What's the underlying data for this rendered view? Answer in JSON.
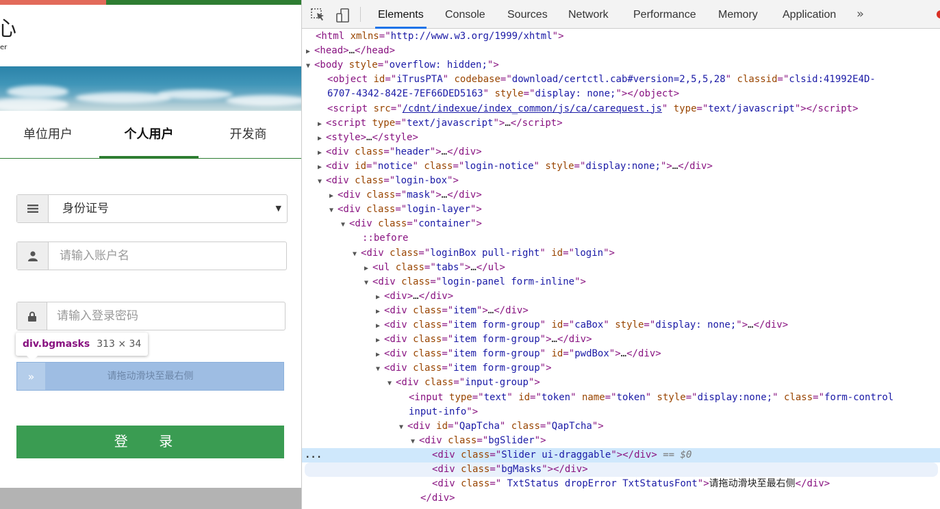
{
  "page": {
    "logo": {
      "glyph": "心",
      "text": "er"
    },
    "tabs": [
      {
        "label": "单位用户",
        "active": false
      },
      {
        "label": "个人用户",
        "active": true
      },
      {
        "label": "开发商",
        "active": false
      }
    ],
    "id_type": {
      "value": "身份证号",
      "icon": "list-icon"
    },
    "account": {
      "placeholder": "请输入账户名",
      "icon": "user-icon"
    },
    "password": {
      "placeholder": "请输入登录密码",
      "icon": "lock-icon"
    },
    "tooltip": {
      "tag": "div.bgmasks",
      "size": "313 × 34"
    },
    "slider": {
      "text": "请拖动滑块至最右侧",
      "handle": "»"
    },
    "login_label": "登 录"
  },
  "devtools": {
    "panels": [
      {
        "label": "Elements",
        "active": true
      },
      {
        "label": "Console"
      },
      {
        "label": "Sources"
      },
      {
        "label": "Network"
      },
      {
        "label": "Performance"
      },
      {
        "label": "Memory"
      },
      {
        "label": "Application"
      }
    ],
    "more": "»",
    "lines": [
      {
        "indent": 0,
        "tri": "",
        "html": "<span class=\"tg\">&lt;html</span> <span class=\"an\">xmlns</span><span class=\"tg\">=</span>\"<span class=\"av\">http://www.w3.org/1999/xhtml</span>\"<span class=\"tg\">&gt;</span>"
      },
      {
        "indent": 0,
        "tri": "▶",
        "html": "<span class=\"tg\">&lt;head&gt;</span><span class=\"tx\">…</span><span class=\"tg\">&lt;/head&gt;</span>"
      },
      {
        "indent": 0,
        "tri": "▼",
        "html": "<span class=\"tg\">&lt;body</span> <span class=\"an\">style</span><span class=\"tg\">=</span>\"<span class=\"av\">overflow: hidden;</span>\"<span class=\"tg\">&gt;</span>"
      },
      {
        "indent": 1,
        "tri": "",
        "html": "<span class=\"tg\">&lt;object</span> <span class=\"an\">id</span><span class=\"tg\">=</span>\"<span class=\"av\">iTrusPTA</span>\" <span class=\"an\">codebase</span><span class=\"tg\">=</span>\"<span class=\"av\">download/certctl.cab#version=2,5,5,28</span>\" <span class=\"an\">classid</span><span class=\"tg\">=</span>\"<span class=\"av\">clsid:41992E4D-</span>"
      },
      {
        "indent": 1,
        "tri": "",
        "html": "<span class=\"av\">6707-4342-842E-7EF66DED5163</span>\" <span class=\"an\">style</span><span class=\"tg\">=</span>\"<span class=\"av\">display: none;</span>\"<span class=\"tg\">&gt;&lt;/object&gt;</span>"
      },
      {
        "indent": 1,
        "tri": "",
        "html": "<span class=\"tg\">&lt;script</span> <span class=\"an\">src</span><span class=\"tg\">=</span>\"<span class=\"lk\">/cdnt/indexue/index_common/js/ca/carequest.js</span>\" <span class=\"an\">type</span><span class=\"tg\">=</span>\"<span class=\"av\">text/javascript</span>\"<span class=\"tg\">&gt;&lt;/script&gt;</span>"
      },
      {
        "indent": 1,
        "tri": "▶",
        "html": "<span class=\"tg\">&lt;script</span> <span class=\"an\">type</span><span class=\"tg\">=</span>\"<span class=\"av\">text/javascript</span>\"<span class=\"tg\">&gt;</span><span class=\"tx\">…</span><span class=\"tg\">&lt;/script&gt;</span>"
      },
      {
        "indent": 1,
        "tri": "▶",
        "html": "<span class=\"tg\">&lt;style&gt;</span><span class=\"tx\">…</span><span class=\"tg\">&lt;/style&gt;</span>"
      },
      {
        "indent": 1,
        "tri": "▶",
        "html": "<span class=\"tg\">&lt;div</span> <span class=\"an\">class</span><span class=\"tg\">=</span>\"<span class=\"av\">header</span>\"<span class=\"tg\">&gt;</span><span class=\"tx\">…</span><span class=\"tg\">&lt;/div&gt;</span>"
      },
      {
        "indent": 1,
        "tri": "▶",
        "html": "<span class=\"tg\">&lt;div</span> <span class=\"an\">id</span><span class=\"tg\">=</span>\"<span class=\"av\">notice</span>\" <span class=\"an\">class</span><span class=\"tg\">=</span>\"<span class=\"av\">login-notice</span>\" <span class=\"an\">style</span><span class=\"tg\">=</span>\"<span class=\"av\">display:none;</span>\"<span class=\"tg\">&gt;</span><span class=\"tx\">…</span><span class=\"tg\">&lt;/div&gt;</span>"
      },
      {
        "indent": 1,
        "tri": "▼",
        "html": "<span class=\"tg\">&lt;div</span> <span class=\"an\">class</span><span class=\"tg\">=</span>\"<span class=\"av\">login-box</span>\"<span class=\"tg\">&gt;</span>"
      },
      {
        "indent": 2,
        "tri": "▶",
        "html": "<span class=\"tg\">&lt;div</span> <span class=\"an\">class</span><span class=\"tg\">=</span>\"<span class=\"av\">mask</span>\"<span class=\"tg\">&gt;</span><span class=\"tx\">…</span><span class=\"tg\">&lt;/div&gt;</span>"
      },
      {
        "indent": 2,
        "tri": "▼",
        "html": "<span class=\"tg\">&lt;div</span> <span class=\"an\">class</span><span class=\"tg\">=</span>\"<span class=\"av\">login-layer</span>\"<span class=\"tg\">&gt;</span>"
      },
      {
        "indent": 3,
        "tri": "▼",
        "html": "<span class=\"tg\">&lt;div</span> <span class=\"an\">class</span><span class=\"tg\">=</span>\"<span class=\"av\">container</span>\"<span class=\"tg\">&gt;</span>"
      },
      {
        "indent": 4,
        "tri": "",
        "html": "<span class=\"ps\">::before</span>"
      },
      {
        "indent": 4,
        "tri": "▼",
        "html": "<span class=\"tg\">&lt;div</span> <span class=\"an\">class</span><span class=\"tg\">=</span>\"<span class=\"av\">loginBox pull-right</span>\" <span class=\"an\">id</span><span class=\"tg\">=</span>\"<span class=\"av\">login</span>\"<span class=\"tg\">&gt;</span>"
      },
      {
        "indent": 5,
        "tri": "▶",
        "html": "<span class=\"tg\">&lt;ul</span> <span class=\"an\">class</span><span class=\"tg\">=</span>\"<span class=\"av\">tabs</span>\"<span class=\"tg\">&gt;</span><span class=\"tx\">…</span><span class=\"tg\">&lt;/ul&gt;</span>"
      },
      {
        "indent": 5,
        "tri": "▼",
        "html": "<span class=\"tg\">&lt;div</span> <span class=\"an\">class</span><span class=\"tg\">=</span>\"<span class=\"av\">login-panel form-inline</span>\"<span class=\"tg\">&gt;</span>"
      },
      {
        "indent": 6,
        "tri": "▶",
        "html": "<span class=\"tg\">&lt;div&gt;</span><span class=\"tx\">…</span><span class=\"tg\">&lt;/div&gt;</span>"
      },
      {
        "indent": 6,
        "tri": "▶",
        "html": "<span class=\"tg\">&lt;div</span> <span class=\"an\">class</span><span class=\"tg\">=</span>\"<span class=\"av\">item</span>\"<span class=\"tg\">&gt;</span><span class=\"tx\">…</span><span class=\"tg\">&lt;/div&gt;</span>"
      },
      {
        "indent": 6,
        "tri": "▶",
        "html": "<span class=\"tg\">&lt;div</span> <span class=\"an\">class</span><span class=\"tg\">=</span>\"<span class=\"av\">item form-group</span>\" <span class=\"an\">id</span><span class=\"tg\">=</span>\"<span class=\"av\">caBox</span>\" <span class=\"an\">style</span><span class=\"tg\">=</span>\"<span class=\"av\">display: none;</span>\"<span class=\"tg\">&gt;</span><span class=\"tx\">…</span><span class=\"tg\">&lt;/div&gt;</span>"
      },
      {
        "indent": 6,
        "tri": "▶",
        "html": "<span class=\"tg\">&lt;div</span> <span class=\"an\">class</span><span class=\"tg\">=</span>\"<span class=\"av\">item form-group</span>\"<span class=\"tg\">&gt;</span><span class=\"tx\">…</span><span class=\"tg\">&lt;/div&gt;</span>"
      },
      {
        "indent": 6,
        "tri": "▶",
        "html": "<span class=\"tg\">&lt;div</span> <span class=\"an\">class</span><span class=\"tg\">=</span>\"<span class=\"av\">item form-group</span>\" <span class=\"an\">id</span><span class=\"tg\">=</span>\"<span class=\"av\">pwdBox</span>\"<span class=\"tg\">&gt;</span><span class=\"tx\">…</span><span class=\"tg\">&lt;/div&gt;</span>"
      },
      {
        "indent": 6,
        "tri": "▼",
        "html": "<span class=\"tg\">&lt;div</span> <span class=\"an\">class</span><span class=\"tg\">=</span>\"<span class=\"av\">item form-group</span>\"<span class=\"tg\">&gt;</span>"
      },
      {
        "indent": 7,
        "tri": "▼",
        "html": "<span class=\"tg\">&lt;div</span> <span class=\"an\">class</span><span class=\"tg\">=</span>\"<span class=\"av\">input-group</span>\"<span class=\"tg\">&gt;</span>"
      },
      {
        "indent": 8,
        "tri": "",
        "html": "<span class=\"tg\">&lt;input</span> <span class=\"an\">type</span><span class=\"tg\">=</span>\"<span class=\"av\">text</span>\" <span class=\"an\">id</span><span class=\"tg\">=</span>\"<span class=\"av\">token</span>\" <span class=\"an\">name</span><span class=\"tg\">=</span>\"<span class=\"av\">token</span>\" <span class=\"an\">style</span><span class=\"tg\">=</span>\"<span class=\"av\">display:none;</span>\" <span class=\"an\">class</span><span class=\"tg\">=</span>\"<span class=\"av\">form-control</span>"
      },
      {
        "indent": 8,
        "tri": "",
        "html": "<span class=\"av\">input-info</span>\"<span class=\"tg\">&gt;</span>"
      },
      {
        "indent": 8,
        "tri": "▼",
        "html": "<span class=\"tg\">&lt;div</span> <span class=\"an\">id</span><span class=\"tg\">=</span>\"<span class=\"av\">QapTcha</span>\" <span class=\"an\">class</span><span class=\"tg\">=</span>\"<span class=\"av\">QapTcha</span>\"<span class=\"tg\">&gt;</span>"
      },
      {
        "indent": 9,
        "tri": "▼",
        "html": "<span class=\"tg\">&lt;div</span> <span class=\"an\">class</span><span class=\"tg\">=</span>\"<span class=\"av\">bgSlider</span>\"<span class=\"tg\">&gt;</span>"
      },
      {
        "indent": 10,
        "tri": "",
        "sel": true,
        "html": "<span class=\"tg\">&lt;div</span> <span class=\"an\">class</span><span class=\"tg\">=</span>\"<span class=\"av\">Slider ui-draggable</span>\"<span class=\"tg\">&gt;&lt;/div&gt;</span> <span class=\"eq\">== $0</span>"
      },
      {
        "indent": 10,
        "tri": "",
        "hov": true,
        "html": "<span class=\"tg\">&lt;div</span> <span class=\"an\">class</span><span class=\"tg\">=</span>\"<span class=\"av\">bgMasks</span>\"<span class=\"tg\">&gt;&lt;/div&gt;</span>"
      },
      {
        "indent": 10,
        "tri": "",
        "html": "<span class=\"tg\">&lt;div</span> <span class=\"an\">class</span><span class=\"tg\">=</span>\"<span class=\"av\"> TxtStatus dropError TxtStatusFont</span>\"<span class=\"tg\">&gt;</span><span class=\"tx\">请拖动滑块至最右侧</span><span class=\"tg\">&lt;/div&gt;</span>"
      },
      {
        "indent": 9,
        "tri": "",
        "html": "<span class=\"tg\">&lt;/div&gt;</span>"
      }
    ]
  },
  "colors": {
    "accent_green": "#2e7d32",
    "button_green": "#3a9c52",
    "slider_blue": "#9ebde3",
    "devtools_blue": "#1a73e8"
  }
}
